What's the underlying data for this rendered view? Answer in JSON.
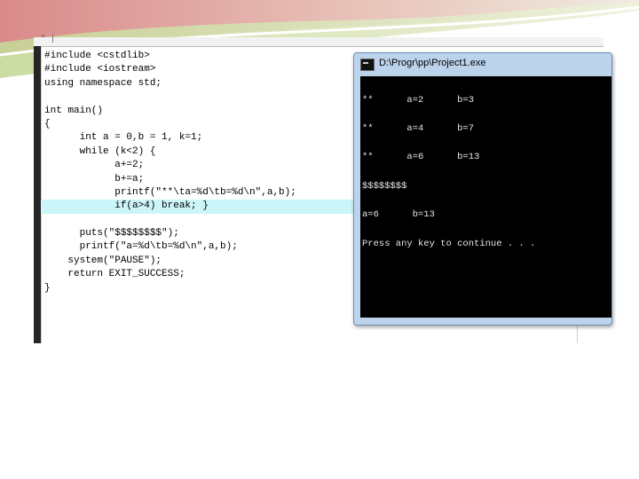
{
  "editor": {
    "tab_marker": "\" |",
    "code_lines": [
      "#include <cstdlib>",
      "#include <iostream>",
      "using namespace std;",
      "",
      "int main()",
      "{",
      "      int a = 0,b = 1, k=1;",
      "      while (k<2) {",
      "            a+=2;",
      "            b+=a;",
      "            printf(\"**\\ta=%d\\tb=%d\\n\",a,b);",
      "            if(a>4) break; }",
      "",
      "      puts(\"$$$$$$$$\");",
      "      printf(\"a=%d\\tb=%d\\n\",a,b);",
      "    system(\"PAUSE\");",
      "    return EXIT_SUCCESS;",
      "}"
    ],
    "highlighted_line_index": 11
  },
  "console_window": {
    "title": "D:\\Progr\\pp\\Project1.exe",
    "output_lines": [
      "**      a=2      b=3",
      "**      a=4      b=7",
      "**      a=6      b=13",
      "$$$$$$$$",
      "a=6      b=13",
      "Press any key to continue . . ."
    ]
  },
  "colors": {
    "highlight": "#ccf5f9",
    "console_bg": "#000000",
    "console_text": "#e6e6e6",
    "window_frame": "#bcd3ec",
    "deco_green": "#c9dba0",
    "deco_red": "#c9787a"
  },
  "icons": {
    "console_app": "console-app-icon"
  }
}
